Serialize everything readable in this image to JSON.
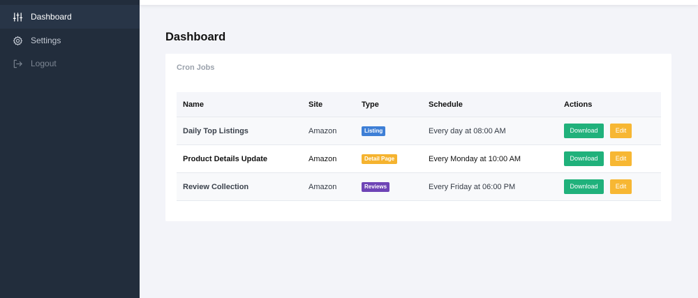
{
  "sidebar": {
    "items": [
      {
        "label": "Dashboard",
        "icon": "sliders-icon",
        "active": true
      },
      {
        "label": "Settings",
        "icon": "gear-icon",
        "active": false
      },
      {
        "label": "Logout",
        "icon": "logout-icon",
        "active": false
      }
    ]
  },
  "main": {
    "title": "Dashboard",
    "card_title": "Cron Jobs",
    "table": {
      "headers": [
        "Name",
        "Site",
        "Type",
        "Schedule",
        "Actions"
      ],
      "rows": [
        {
          "name": "Daily Top Listings",
          "site": "Amazon",
          "type": "Listing",
          "type_color": "#3e7fd6",
          "schedule": "Every day at 08:00 AM",
          "download": "Download",
          "edit": "Edit"
        },
        {
          "name": "Product Details Update",
          "site": "Amazon",
          "type": "Detail Page",
          "type_color": "#f5b32f",
          "schedule": "Every Monday at 10:00 AM",
          "download": "Download",
          "edit": "Edit"
        },
        {
          "name": "Review Collection",
          "site": "Amazon",
          "type": "Reviews",
          "type_color": "#6e44b6",
          "schedule": "Every Friday at 06:00 PM",
          "download": "Download",
          "edit": "Edit"
        }
      ]
    }
  },
  "colors": {
    "sidebar_bg": "#222d3c",
    "download": "#20b17b",
    "edit": "#f7b733"
  }
}
